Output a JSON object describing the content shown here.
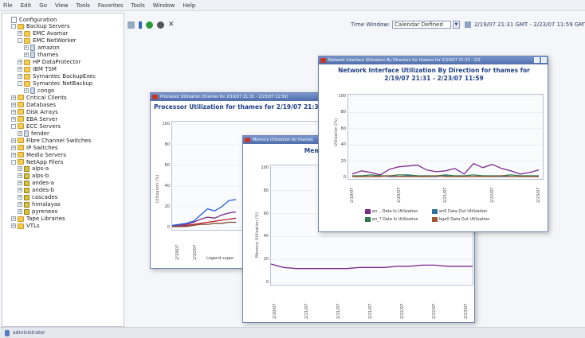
{
  "menu": [
    "File",
    "Edit",
    "Go",
    "View",
    "Tools",
    "Favorites",
    "Tools",
    "Window",
    "Help"
  ],
  "sidebar": {
    "items": [
      {
        "label": "Configuration",
        "level": 0,
        "icon": "config-icon",
        "toggle": ""
      },
      {
        "label": "Backup Servers",
        "level": 1,
        "icon": "folder-icon",
        "toggle": "-"
      },
      {
        "label": "EMC Avamar",
        "level": 2,
        "icon": "folder-icon",
        "toggle": "+"
      },
      {
        "label": "EMC NetWorker",
        "level": 2,
        "icon": "folder-icon",
        "toggle": "-"
      },
      {
        "label": "amazon",
        "level": 3,
        "icon": "server-icon",
        "toggle": "+"
      },
      {
        "label": "thames",
        "level": 3,
        "icon": "server-icon",
        "toggle": "+"
      },
      {
        "label": "HP DataProtector",
        "level": 2,
        "icon": "folder-icon",
        "toggle": "+"
      },
      {
        "label": "IBM TSM",
        "level": 2,
        "icon": "folder-icon",
        "toggle": "+"
      },
      {
        "label": "Symantec BackupExec",
        "level": 2,
        "icon": "folder-icon",
        "toggle": "+"
      },
      {
        "label": "Symantec NetBackup",
        "level": 2,
        "icon": "folder-icon",
        "toggle": "-"
      },
      {
        "label": "congo",
        "level": 3,
        "icon": "server-icon",
        "toggle": "+"
      },
      {
        "label": "Critical Clients",
        "level": 1,
        "icon": "folder-icon",
        "toggle": "+"
      },
      {
        "label": "Databases",
        "level": 1,
        "icon": "folder-icon",
        "toggle": "+"
      },
      {
        "label": "Disk Arrays",
        "level": 1,
        "icon": "folder-icon",
        "toggle": "+"
      },
      {
        "label": "EBA Server",
        "level": 1,
        "icon": "folder-icon",
        "toggle": "+"
      },
      {
        "label": "ECC Servers",
        "level": 1,
        "icon": "folder-icon",
        "toggle": "-"
      },
      {
        "label": "fender",
        "level": 2,
        "icon": "server-icon",
        "toggle": "+"
      },
      {
        "label": "Fibre Channel Switches",
        "level": 1,
        "icon": "folder-icon",
        "toggle": "+"
      },
      {
        "label": "IP Switches",
        "level": 1,
        "icon": "folder-icon",
        "toggle": "+"
      },
      {
        "label": "Media Servers",
        "level": 1,
        "icon": "folder-icon",
        "toggle": "+"
      },
      {
        "label": "NetApp Filers",
        "level": 1,
        "icon": "folder-icon",
        "toggle": "-"
      },
      {
        "label": "alps-a",
        "level": 2,
        "icon": "filer-icon",
        "toggle": "+"
      },
      {
        "label": "alps-b",
        "level": 2,
        "icon": "filer-icon",
        "toggle": "+"
      },
      {
        "label": "andes-a",
        "level": 2,
        "icon": "filer-icon",
        "toggle": "+"
      },
      {
        "label": "andes-b",
        "level": 2,
        "icon": "filer-icon",
        "toggle": "+"
      },
      {
        "label": "cascades",
        "level": 2,
        "icon": "filer-icon",
        "toggle": "+"
      },
      {
        "label": "himalayas",
        "level": 2,
        "icon": "filer-icon",
        "toggle": "+"
      },
      {
        "label": "pyrenees",
        "level": 2,
        "icon": "filer-icon",
        "toggle": "+"
      },
      {
        "label": "Tape Libraries",
        "level": 1,
        "icon": "folder-icon",
        "toggle": "+"
      },
      {
        "label": "VTLs",
        "level": 1,
        "icon": "folder-icon",
        "toggle": "+"
      }
    ]
  },
  "toolbar": {
    "time_window_label": "Time Window:",
    "time_window_value": "Calendar Defined",
    "time_range": "2/19/07 21:31 GMT - 2/23/07 11:59 GMT"
  },
  "status": {
    "user": "administrator"
  },
  "windows": {
    "processor": {
      "titlebar": "Processor Utilization (thames for 2/19/07 21:31 - 2/23/07 11:59)",
      "title": "Processor Utilization for thames for 2/19/07 21:31",
      "ylabel": "Utilization (%)",
      "legend_label": "Legend suppr"
    },
    "memory": {
      "titlebar": "Memory Utilization for thames",
      "title": "Memory Ut",
      "ylabel": "Memory Utilization (%)"
    },
    "network": {
      "titlebar": "Network Interface Utilization By Direction for thames for 2/19/07 21:31 - 2/2",
      "title_line1": "Network Interface Utilization By Direction for thames for",
      "title_line2": "2/19/07 21:31 - 2/23/07 11:59",
      "ylabel": "Utilization (%)",
      "legend": [
        {
          "label": "en... Data In Utilization",
          "color": "#7a2a8c"
        },
        {
          "label": "en0 Data Out Utilization",
          "color": "#2f6fa0"
        },
        {
          "label": "en_? Data In Utilization",
          "color": "#2f7a4a"
        },
        {
          "label": "bge0 Data Out Utilization",
          "color": "#a2542e"
        }
      ]
    }
  },
  "chart_data": [
    {
      "type": "line",
      "title": "Processor Utilization for thames for 2/19/07 21:31",
      "ylabel": "Utilization (%)",
      "ylim": [
        0,
        100
      ],
      "yticks": [
        0,
        20,
        40,
        60,
        80,
        100
      ],
      "x": [
        "2/19/07",
        "2/20/07"
      ],
      "series": [
        {
          "color": "#1f5bd6",
          "values": [
            2,
            3,
            4,
            6,
            12,
            18,
            16,
            20,
            26,
            27
          ]
        },
        {
          "color": "#7a2a8c",
          "values": [
            1,
            2,
            3,
            5,
            8,
            10,
            9,
            12,
            14,
            15
          ]
        },
        {
          "color": "#c21f2f",
          "values": [
            1,
            1,
            2,
            3,
            4,
            5,
            6,
            7,
            8,
            9
          ]
        },
        {
          "color": "#7b4a2a",
          "values": [
            1,
            1,
            1,
            2,
            3,
            3,
            4,
            4,
            5,
            5
          ]
        }
      ]
    },
    {
      "type": "line",
      "title": "Memory Ut",
      "ylabel": "Memory Utilization (%)",
      "ylim": [
        0,
        100
      ],
      "yticks": [
        0,
        20,
        40,
        60,
        80,
        100
      ],
      "x": [
        "2/20/07",
        "2/21/07",
        "2/21/07",
        "2/21/07",
        "2/22/07",
        "2/22/07",
        "2/23/07"
      ],
      "series": [
        {
          "color": "#7a2a8c",
          "values": [
            16,
            13,
            12,
            12,
            12,
            12,
            12,
            13,
            13,
            13,
            14,
            14,
            15,
            15,
            14,
            14,
            14
          ]
        }
      ]
    },
    {
      "type": "line",
      "title": "Network Interface Utilization By Direction for thames for 2/19/07 21:31 - 2/23/07 11:59",
      "ylabel": "Utilization (%)",
      "ylim": [
        0,
        100
      ],
      "yticks": [
        0,
        20,
        40,
        60,
        80,
        100
      ],
      "x": [
        "2/19/07",
        "2/20/07",
        "2/21/07",
        "2/22/07",
        "2/23/07"
      ],
      "series": [
        {
          "name": "en... Data In Utilization",
          "color": "#7a2a8c",
          "values": [
            4,
            8,
            6,
            3,
            10,
            13,
            14,
            15,
            9,
            7,
            8,
            11,
            4,
            17,
            12,
            16,
            11,
            8,
            4,
            6,
            9
          ]
        },
        {
          "name": "en0 Data Out Utilization",
          "color": "#2f6fa0",
          "values": [
            1,
            1,
            1,
            2,
            1,
            1,
            2,
            1,
            1,
            1,
            2,
            1,
            1,
            1,
            2,
            1,
            1,
            1,
            1,
            1,
            1
          ]
        },
        {
          "name": "en_? Data In Utilization",
          "color": "#2f7a4a",
          "values": [
            2,
            2,
            3,
            2,
            2,
            3,
            3,
            2,
            2,
            2,
            3,
            2,
            2,
            3,
            2,
            2,
            2,
            3,
            2,
            2,
            2
          ]
        },
        {
          "name": "bge0 Data Out Utilization",
          "color": "#a2542e",
          "values": [
            1,
            1,
            1,
            1,
            2,
            1,
            1,
            1,
            1,
            2,
            1,
            1,
            1,
            1,
            1,
            1,
            2,
            1,
            1,
            1,
            1
          ]
        }
      ]
    }
  ]
}
